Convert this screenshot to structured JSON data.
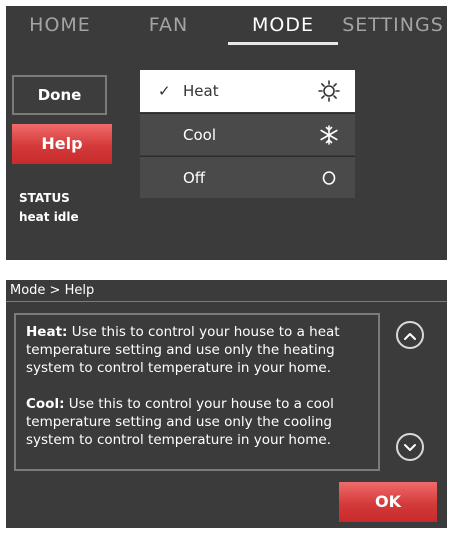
{
  "mode_screen": {
    "tabs": [
      {
        "label": "HOME",
        "active": false
      },
      {
        "label": "FAN",
        "active": false
      },
      {
        "label": "MODE",
        "active": true
      },
      {
        "label": "SETTINGS",
        "active": false
      }
    ],
    "done_label": "Done",
    "help_label": "Help",
    "status": {
      "label": "STATUS",
      "value": "heat idle"
    },
    "modes": [
      {
        "label": "Heat",
        "check": "✓",
        "selected": true,
        "icon": "sun-icon"
      },
      {
        "label": "Cool",
        "check": "",
        "selected": false,
        "icon": "snowflake-icon"
      },
      {
        "label": "Off",
        "check": "",
        "selected": false,
        "icon": "off-circle-icon"
      }
    ],
    "colors": {
      "background": "#3b3b3b",
      "accent_red": "#d43a3a",
      "selected_row": "#ffffff"
    }
  },
  "help_screen": {
    "header": "Mode > Help",
    "paragraphs": [
      {
        "term": "Heat:",
        "text": " Use this to control your house to a heat temperature setting and use only the heating system to control temperature in your home."
      },
      {
        "term": "Cool:",
        "text": " Use this to control your house to a cool temperature setting and use only the cooling system to control temperature in your home."
      }
    ],
    "scroll_up_icon": "chevron-up-icon",
    "scroll_down_icon": "chevron-down-icon",
    "ok_label": "OK"
  }
}
